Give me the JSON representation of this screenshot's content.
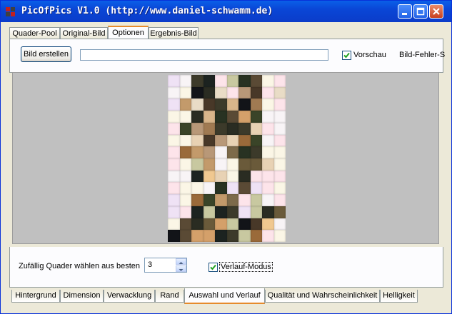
{
  "window": {
    "title": "PicOfPics V1.0 (http://www.daniel-schwamm.de)"
  },
  "icons": {
    "app": "app-icon",
    "minimize": "minimize-icon",
    "maximize": "maximize-icon",
    "close": "close-icon"
  },
  "tabs": [
    {
      "label": "Quader-Pool",
      "active": false
    },
    {
      "label": "Original-Bild",
      "active": false
    },
    {
      "label": "Optionen",
      "active": true
    },
    {
      "label": "Ergebnis-Bild",
      "active": false
    }
  ],
  "toolbar": {
    "build_button": "Bild erstellen",
    "progress": 0,
    "vorschau_label": "Vorschau",
    "vorschau_checked": true,
    "bildfehler_label": "Bild-Fehler-S"
  },
  "options": {
    "random_label": "Zufällig Quader wählen aus besten",
    "random_value": "3",
    "verlauf_label": "Verlauf-Modus",
    "verlauf_checked": true
  },
  "bottom_tabs": [
    {
      "label": "Hintergrund",
      "active": false
    },
    {
      "label": "Dimension",
      "active": false
    },
    {
      "label": "Verwacklung",
      "active": false
    },
    {
      "label": "Rand",
      "active": false
    },
    {
      "label": "Auswahl und Verlauf",
      "active": true
    },
    {
      "label": "Qualität und Wahrscheinlichkeit",
      "active": false
    },
    {
      "label": "Helligkeit",
      "active": false
    }
  ],
  "colors": {
    "title_bar": "#0a46d6",
    "canvas_bg": "#c0c0c0",
    "tab_accent": "#e68b2c",
    "mosaic_palette": [
      "#f8f4f6",
      "#fde4ea",
      "#efe2f5",
      "#fbf6e6",
      "#e9dcc6",
      "#d8b58a",
      "#c39a6b",
      "#a07a52",
      "#7d6a4a",
      "#5a4a35",
      "#3c3a2a",
      "#2a2c22",
      "#1c2320",
      "#121418",
      "#283222",
      "#3a4428",
      "#6a5a3a",
      "#9a6a3a",
      "#d4a06a",
      "#f0c890",
      "#e8d2b4",
      "#c8c8a0",
      "#b89878",
      "#483828"
    ]
  }
}
